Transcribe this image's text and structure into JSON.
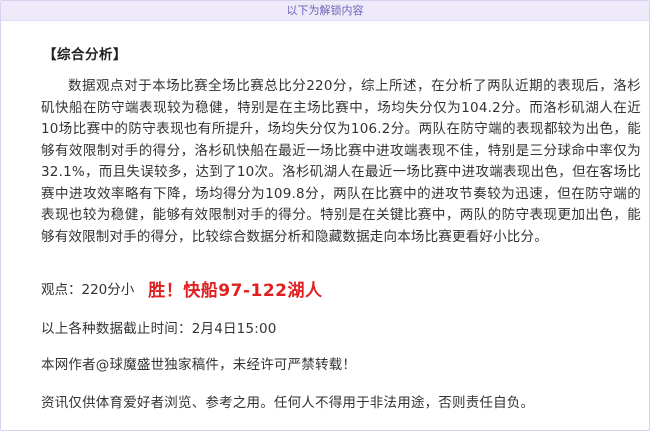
{
  "unlock_banner": "以下为解锁内容",
  "section_title": "【综合分析】",
  "analysis_text": "数据观点对于本场比赛全场比赛总比分220分，综上所述，在分析了两队近期的表现后，洛杉矶快船在防守端表现较为稳健，特别是在主场比赛中，场均失分仅为104.2分。而洛杉矶湖人在近10场比赛中的防守表现也有所提升，场均失分仅为106.2分。两队在防守端的表现都较为出色，能够有效限制对手的得分，洛杉矶快船在最近一场比赛中进攻端表现不佳，特别是三分球命中率仅为32.1%，而且失误较多，达到了10次。洛杉矶湖人在最近一场比赛中进攻端表现出色，但在客场比赛中进攻效率略有下降，场均得分为109.8分，两队在比赛中的进攻节奏较为迅速，但在防守端的表现也较为稳健，能够有效限制对手的得分。特别是在关键比赛中，两队的防守表现更加出色，能够有效限制对手的得分，比较综合数据分析和隐藏数据走向本场比赛更看好小比分。",
  "view": {
    "label": "观点：220分小",
    "verdict": "胜！快船97-122湖人"
  },
  "cutoff_time": "以上各种数据截止时间：2月4日15:00",
  "copyright": "本网作者@球魔盛世独家稿件，未经许可严禁转载！",
  "disclaimer": "资讯仅供体育爱好者浏览、参考之用。任何人不得用于非法用途，否则责任自负。",
  "colors": {
    "banner_bg": "#eeeaf9",
    "banner_text": "#6f63b8",
    "verdict_red": "#e02020"
  }
}
